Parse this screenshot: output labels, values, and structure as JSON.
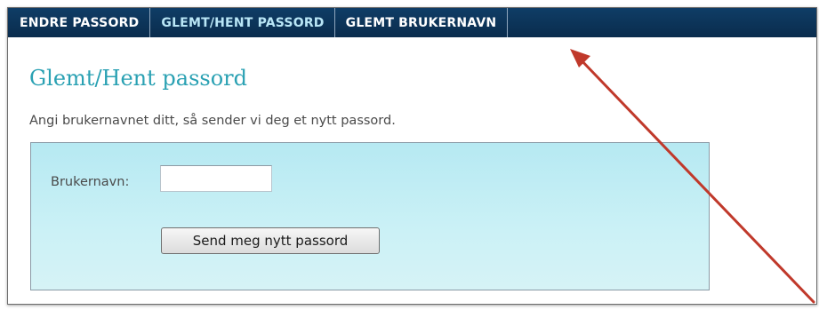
{
  "nav": {
    "tabs": [
      {
        "label": "ENDRE PASSORD",
        "active": false
      },
      {
        "label": "GLEMT/HENT PASSORD",
        "active": true
      },
      {
        "label": "GLEMT BRUKERNAVN",
        "active": false
      }
    ]
  },
  "page": {
    "title": "Glemt/Hent passord",
    "intro": "Angi brukernavnet ditt, så sender vi deg et nytt passord."
  },
  "form": {
    "username_label": "Brukernavn:",
    "username_value": "",
    "submit_label": "Send meg nytt passord"
  },
  "colors": {
    "nav_bg": "#0f3d66",
    "active_tab_text": "#b9e6f6",
    "title": "#2aa1b3",
    "form_bg": "#c6eff5",
    "annotation_arrow": "#c0392b"
  },
  "annotation": {
    "icon": "red-arrow-icon"
  }
}
